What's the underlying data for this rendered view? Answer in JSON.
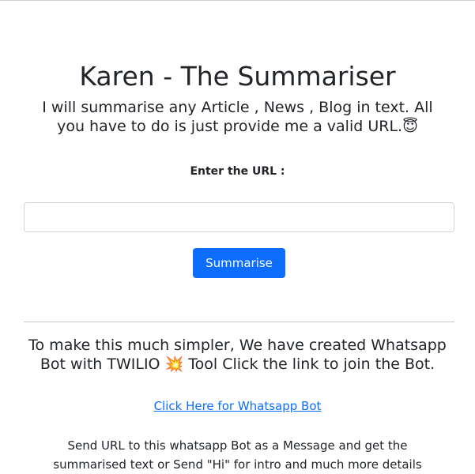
{
  "header": {
    "title": "Karen - The Summariser",
    "subtitle": "I will summarise any Article , News , Blog in text. All you have to do is just provide me a valid URL.😇"
  },
  "form": {
    "label": "Enter the URL :",
    "url_value": "",
    "submit_label": "Summarise",
    "accent": "#0d6efd"
  },
  "whatsapp": {
    "heading": "To make this much simpler, We have created Whatsapp Bot with TWILIO 💥 Tool Click the link to join the Bot.",
    "link_label": "Click Here for Whatsapp Bot",
    "description": "Send URL to this whatsapp Bot as a Message and get the summarised text or Send \"Hi\" for intro and much more details"
  }
}
